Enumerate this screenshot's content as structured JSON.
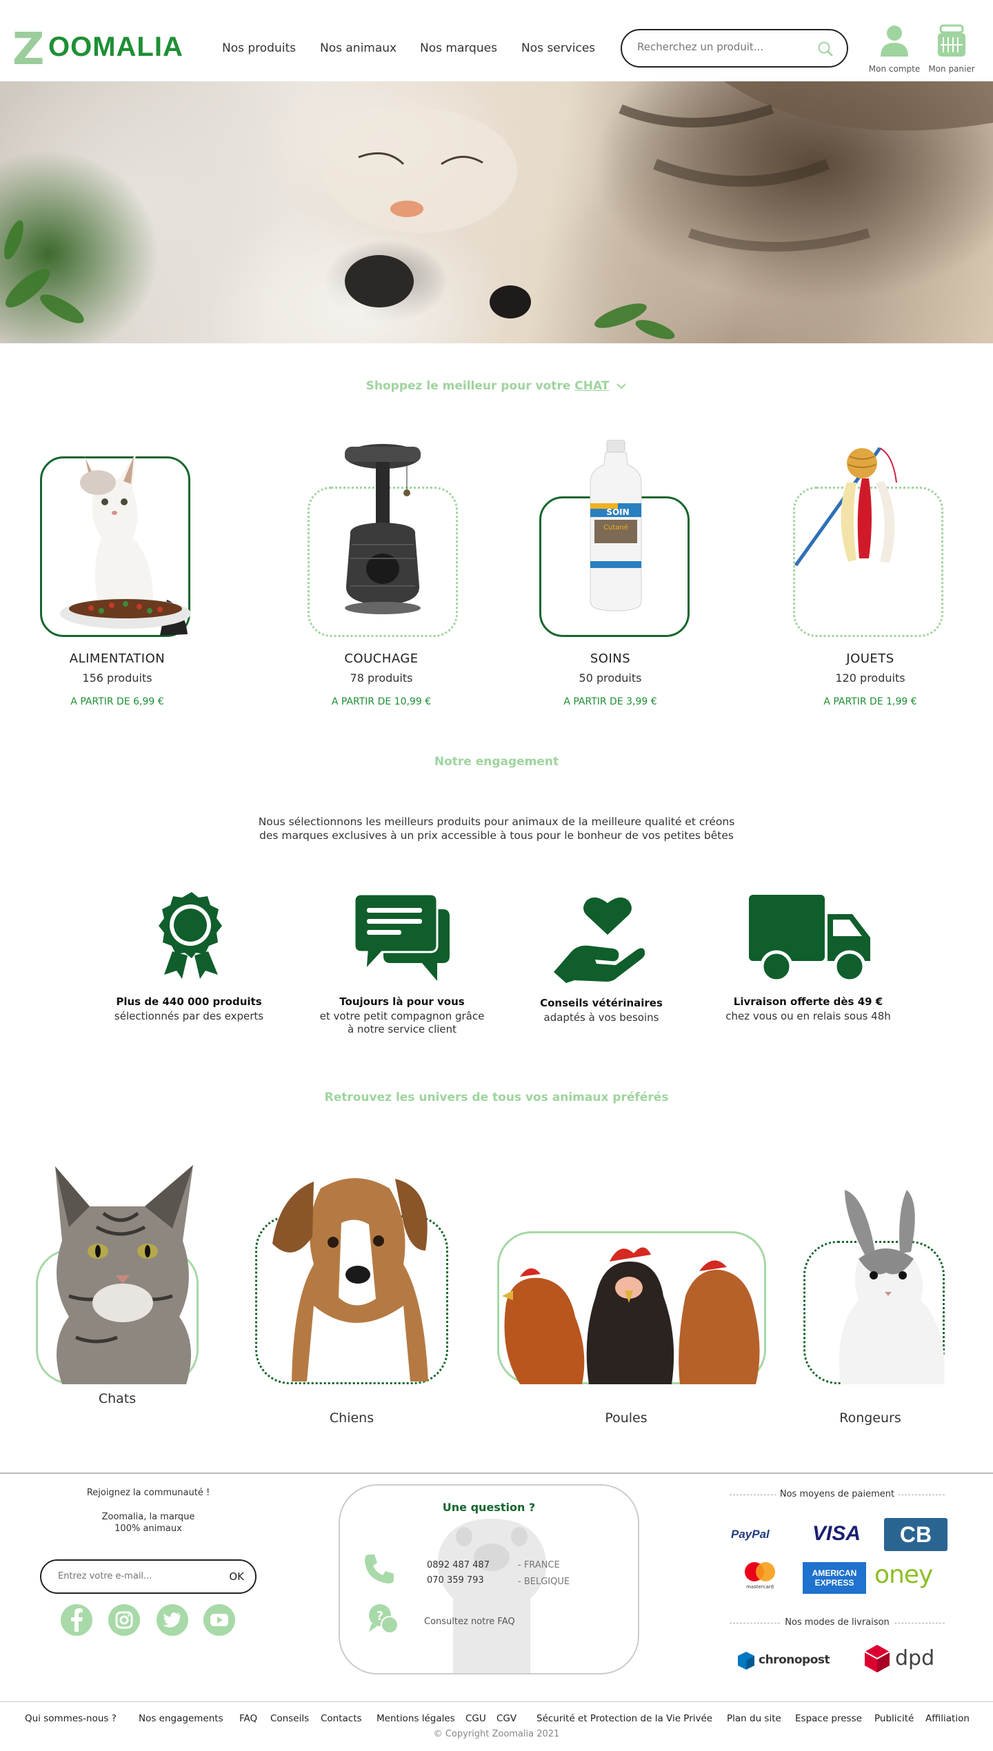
{
  "header": {
    "logo_text": "OOMALIA",
    "logo_letter": "Z",
    "nav": [
      "Nos produits",
      "Nos animaux",
      "Nos marques",
      "Nos services"
    ],
    "search_placeholder": "Recherchez un produit...",
    "account_label": "Mon compte",
    "cart_label": "Mon panier",
    "icons": {
      "search": "search-icon",
      "account": "user-icon",
      "cart": "basket-icon"
    }
  },
  "shop": {
    "title_prefix": "Shoppez le meilleur pour votre",
    "animal": "CHAT",
    "categories": [
      {
        "name": "ALIMENTATION",
        "count": "156 produits",
        "price": "A PARTIR DE 6,99 €"
      },
      {
        "name": "COUCHAGE",
        "count": "78 produits",
        "price": "A PARTIR DE 10,99 €"
      },
      {
        "name": "SOINS",
        "count": "50 produits",
        "price": "A PARTIR DE 3,99 €"
      },
      {
        "name": "JOUETS",
        "count": "120 produits",
        "price": "A PARTIR DE 1,99 €"
      }
    ],
    "product_label": "SOIN",
    "product_sub": "Cutané"
  },
  "engagement": {
    "title": "Notre engagement",
    "text_line1": "Nous sélectionnons les meilleurs produits pour animaux de la meilleure qualité et créons",
    "text_line2": "des marques exclusives à un prix accessible à tous pour le bonheur de vos petites bêtes",
    "features": [
      {
        "title": "Plus de 440 000 produits",
        "sub1": "sélectionnés par des experts",
        "sub2": "",
        "icon": "award-icon"
      },
      {
        "title": "Toujours là pour vous",
        "sub1": "et votre petit compagnon grâce",
        "sub2": "à notre service client",
        "icon": "chat-icon"
      },
      {
        "title": "Conseils vétérinaires",
        "sub1": "adaptés à vos besoins",
        "sub2": "",
        "icon": "heart-hand-icon"
      },
      {
        "title": "Livraison offerte dès 49 €",
        "sub1": "chez vous ou en relais sous 48h",
        "sub2": "",
        "icon": "truck-icon"
      }
    ]
  },
  "universes": {
    "title": "Retrouvez les univers de tous vos animaux préférés",
    "animals": [
      "Chats",
      "Chiens",
      "Poules",
      "Rongeurs"
    ]
  },
  "footer": {
    "community_title": "Rejoignez la communauté !",
    "brand_line1": "Zoomalia, la marque",
    "brand_line2": "100% animaux",
    "email_placeholder": "Entrez votre e-mail...",
    "ok_label": "OK",
    "social_icons": [
      "facebook-icon",
      "instagram-icon",
      "twitter-icon",
      "youtube-icon"
    ],
    "question_title": "Une question ?",
    "phone_fr": "0892 487 487",
    "country_fr": "- FRANCE",
    "phone_be": "070 359 793",
    "country_be": "- BELGIQUE",
    "faq_label": "Consultez notre FAQ",
    "payment_title": "Nos moyens de paiement",
    "payments": [
      "PayPal",
      "VISA",
      "CB",
      "mastercard",
      "AMERICAN EXPRESS",
      "oney"
    ],
    "delivery_title": "Nos modes de livraison",
    "delivery": [
      "chronopost",
      "dpd"
    ],
    "links": [
      "Qui sommes-nous ?",
      "Nos engagements",
      "FAQ",
      "Conseils",
      "Contacts",
      "Mentions légales",
      "CGU",
      "CGV",
      "Sécurité et Protection de la Vie Privée",
      "Plan du site",
      "Espace presse",
      "Publicité",
      "Affiliation"
    ],
    "copyright": "© Copyright Zoomalia 2021"
  },
  "colors": {
    "brand_green": "#1e8f34",
    "dark_green": "#0f5e2b",
    "light_green": "#9fd49f"
  }
}
